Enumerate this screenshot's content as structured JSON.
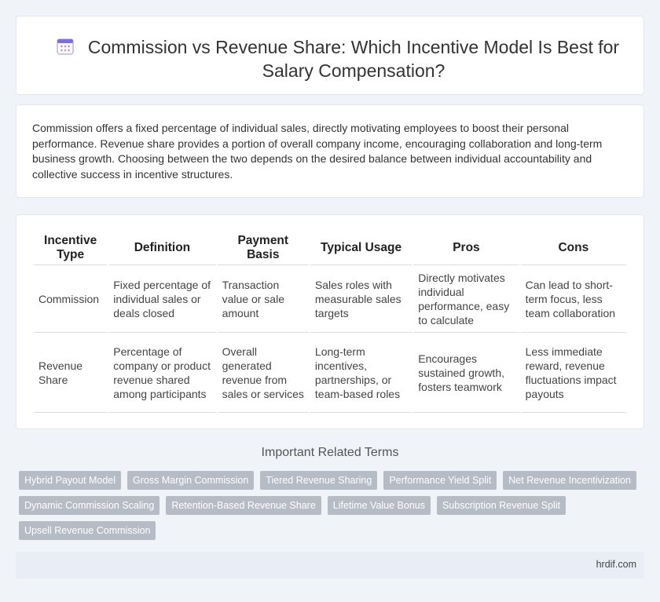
{
  "header": {
    "title": "Commission vs Revenue Share: Which Incentive Model Is Best for Salary Compensation?",
    "icon": "calendar-icon"
  },
  "intro": {
    "text": "Commission offers a fixed percentage of individual sales, directly motivating employees to boost their personal performance. Revenue share provides a portion of overall company income, encouraging collaboration and long-term business growth. Choosing between the two depends on the desired balance between individual accountability and collective success in incentive structures."
  },
  "table": {
    "headers": [
      "Incentive Type",
      "Definition",
      "Payment Basis",
      "Typical Usage",
      "Pros",
      "Cons"
    ],
    "rows": [
      [
        "Commission",
        "Fixed percentage of individual sales or deals closed",
        "Transaction value or sale amount",
        "Sales roles with measurable sales targets",
        "Directly motivates individual performance, easy to calculate",
        "Can lead to short-term focus, less team collaboration"
      ],
      [
        "Revenue Share",
        "Percentage of company or product revenue shared among participants",
        "Overall generated revenue from sales or services",
        "Long-term incentives, partnerships, or team-based roles",
        "Encourages sustained growth, fosters teamwork",
        "Less immediate reward, revenue fluctuations impact payouts"
      ]
    ]
  },
  "related": {
    "heading": "Important Related Terms",
    "terms": [
      "Hybrid Payout Model",
      "Gross Margin Commission",
      "Tiered Revenue Sharing",
      "Performance Yield Split",
      "Net Revenue Incentivization",
      "Dynamic Commission Scaling",
      "Retention-Based Revenue Share",
      "Lifetime Value Bonus",
      "Subscription Revenue Split",
      "Upsell Revenue Commission"
    ]
  },
  "footer": {
    "site": "hrdif.com"
  },
  "colors": {
    "background": "#f0f3f8",
    "chip": "#b6bcc6",
    "footer": "#e8edf6",
    "icon": "#7b6fe0"
  }
}
